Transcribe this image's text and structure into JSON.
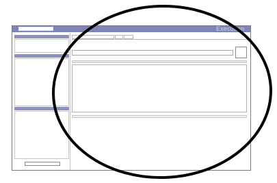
{
  "window": {
    "title": "Execution",
    "title_color": "#cfd5ef",
    "titlebar_color": "#7f86b6"
  },
  "left_pane": {
    "sections": [
      "",
      "",
      ""
    ],
    "header_color": "#8a92bd"
  },
  "right_pane": {
    "tabs": [
      "",
      "",
      ""
    ],
    "input_value": "",
    "content": ""
  },
  "annotation": {
    "shape": "ellipse",
    "stroke_color": "#000000"
  }
}
